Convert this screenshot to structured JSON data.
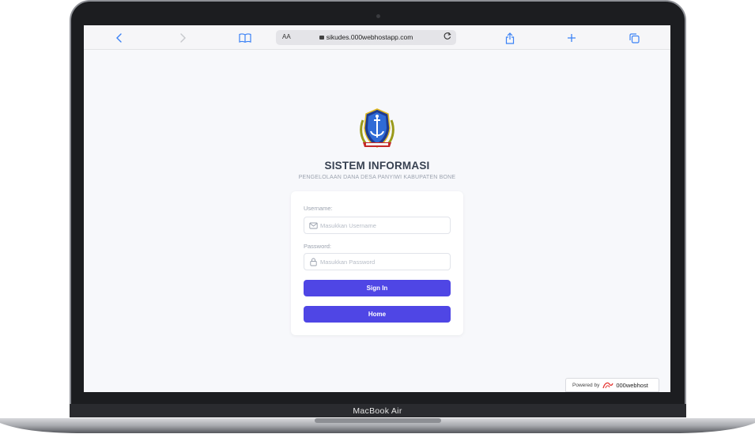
{
  "device": {
    "model_label": "MacBook Air"
  },
  "browser": {
    "text_size_label": "AA",
    "url": "sikudes.000webhostapp.com",
    "icons": {
      "back": "chevron-left-icon",
      "forward": "chevron-right-icon",
      "bookmarks": "book-icon",
      "lock": "lock-icon",
      "reload": "reload-icon",
      "share": "share-icon",
      "new_tab": "plus-icon",
      "tabs": "tabs-icon"
    },
    "accent_color": "#3b82f6"
  },
  "login": {
    "title": "SISTEM INFORMASI",
    "subtitle": "PENGELOLAAN DANA DESA PANYIWI KABUPATEN BONE",
    "username_label": "Username:",
    "username_placeholder": "Masukkan Username",
    "password_label": "Password:",
    "password_placeholder": "Masukkan Password",
    "signin_label": "Sign In",
    "home_label": "Home",
    "button_color": "#4f46e5",
    "logo_icon": "kabupaten-bone-emblem"
  },
  "footer_badge": {
    "prefix": "Powered by",
    "brand": "000webhost"
  }
}
